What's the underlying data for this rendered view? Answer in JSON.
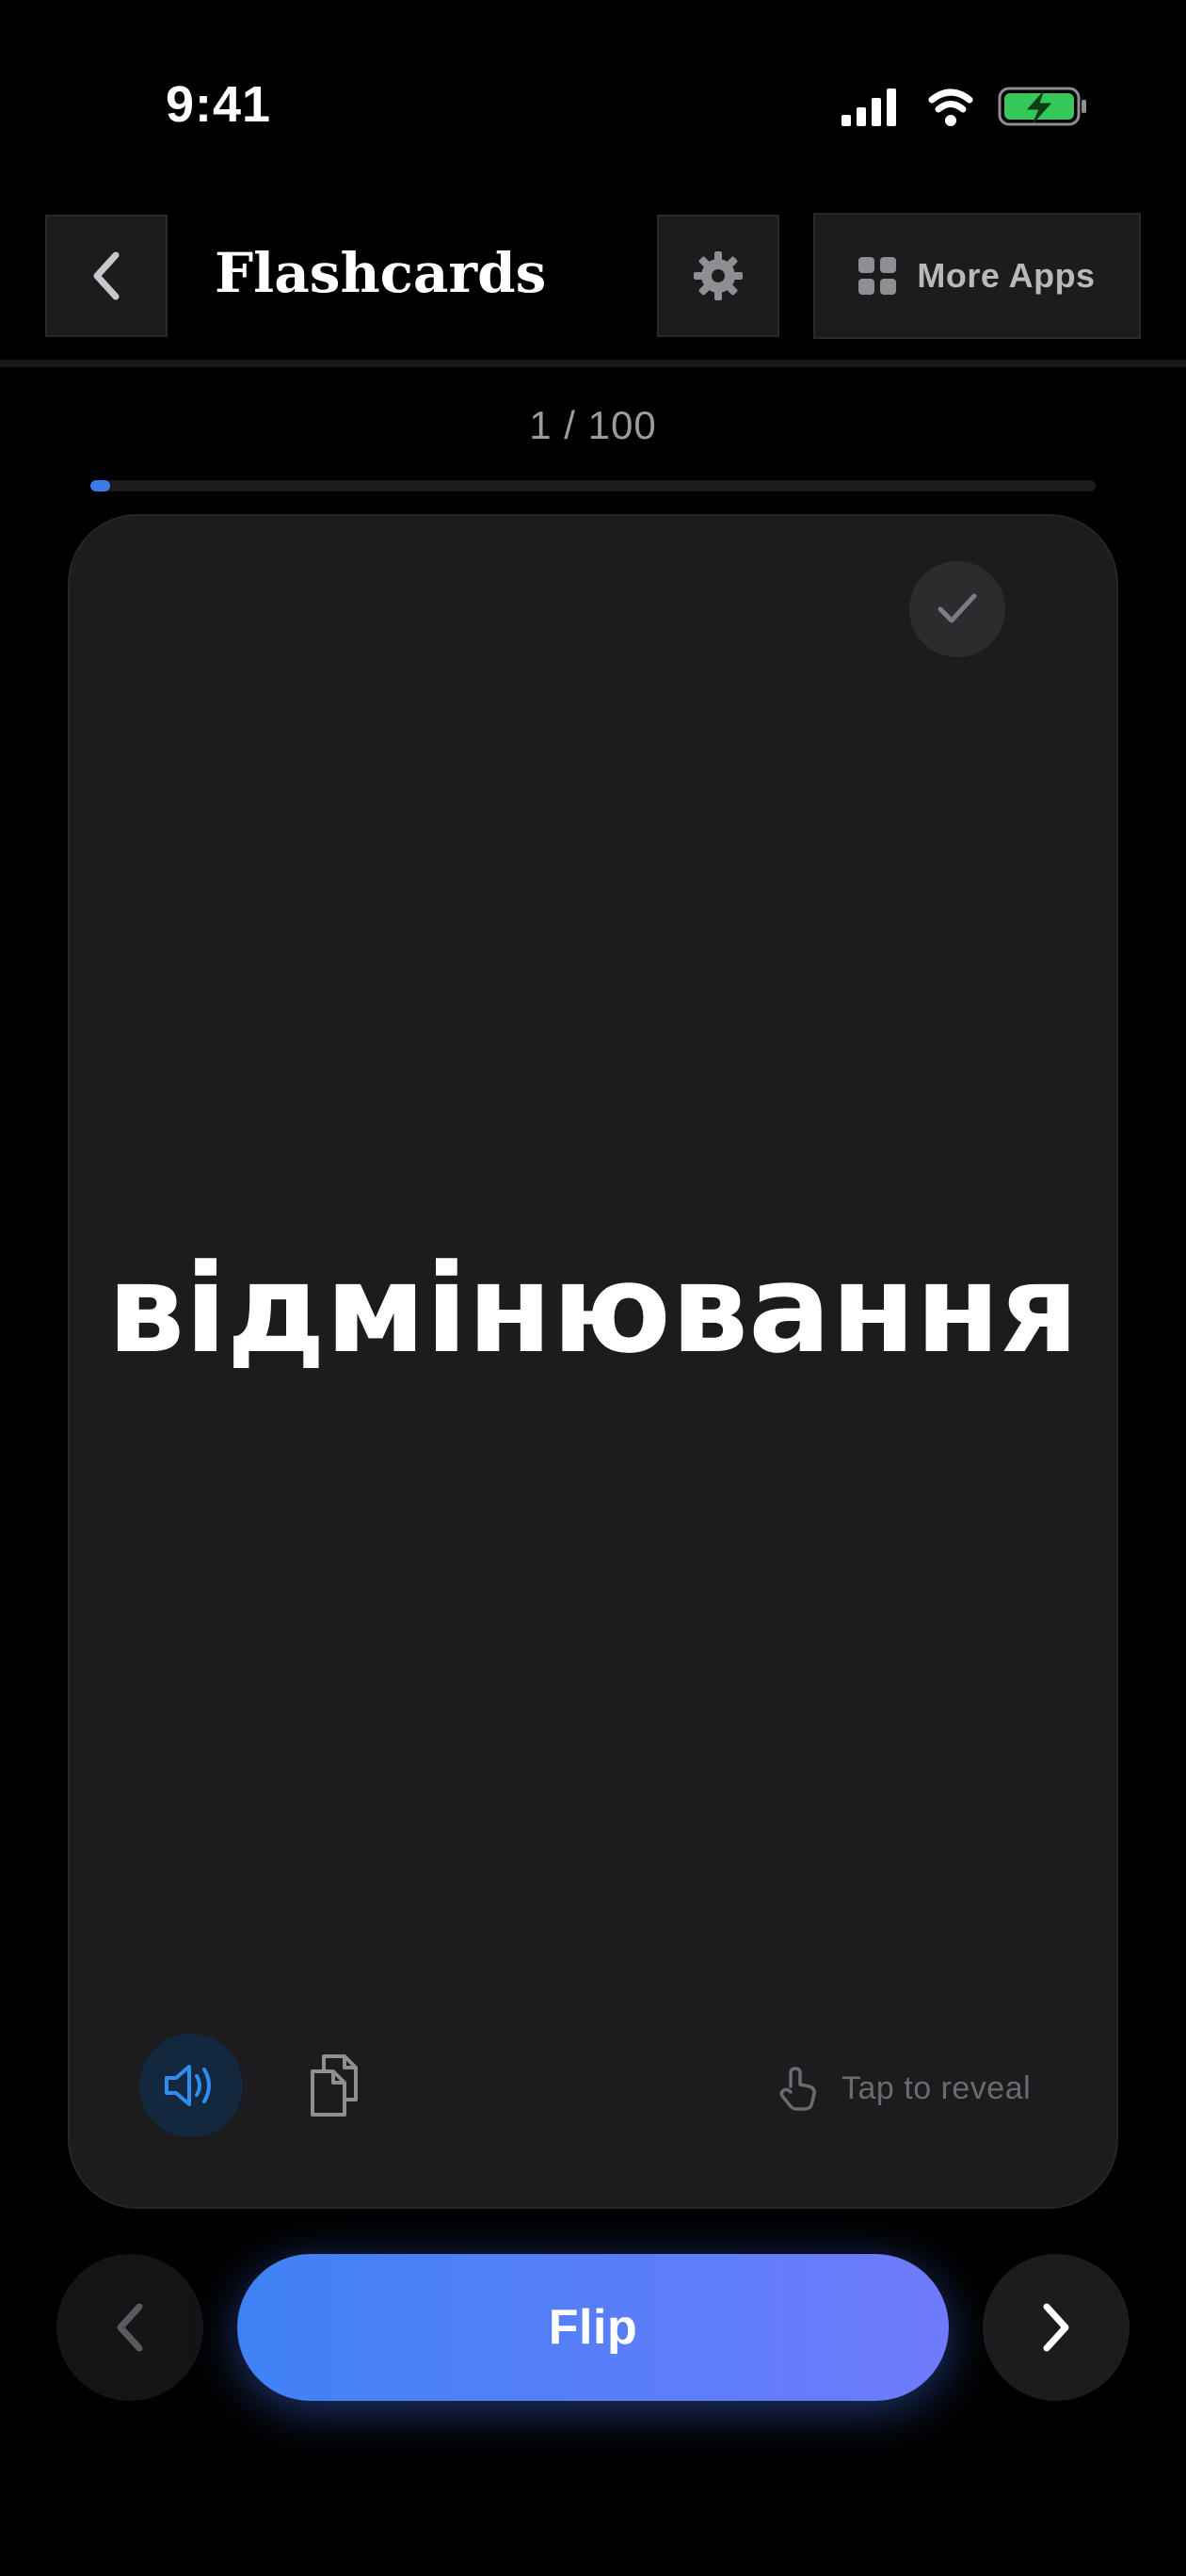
{
  "status_bar": {
    "time": "9:41"
  },
  "header": {
    "title": "Flashcards",
    "more_apps_label": "More Apps"
  },
  "progress": {
    "label": "1 / 100",
    "current": 1,
    "total": 100,
    "fraction": 0.01
  },
  "card": {
    "word": "відмінювання",
    "reveal_hint": "Tap to reveal"
  },
  "controls": {
    "flip_label": "Flip"
  },
  "colors": {
    "background": "#000000",
    "card": "#1c1c1e",
    "accent": "#3f82f5",
    "flip_gradient_end": "#6f7bfb",
    "battery_green": "#34c759",
    "speaker_blue": "#2f8cf0"
  },
  "icons": {
    "back": "chevron-left-icon",
    "settings": "gear-icon",
    "more_apps": "grid-icon",
    "check": "checkmark-icon",
    "speak": "speaker-icon",
    "copy": "copy-icon",
    "reveal": "tap-hand-icon",
    "prev": "chevron-left-icon",
    "next": "chevron-right-icon"
  }
}
